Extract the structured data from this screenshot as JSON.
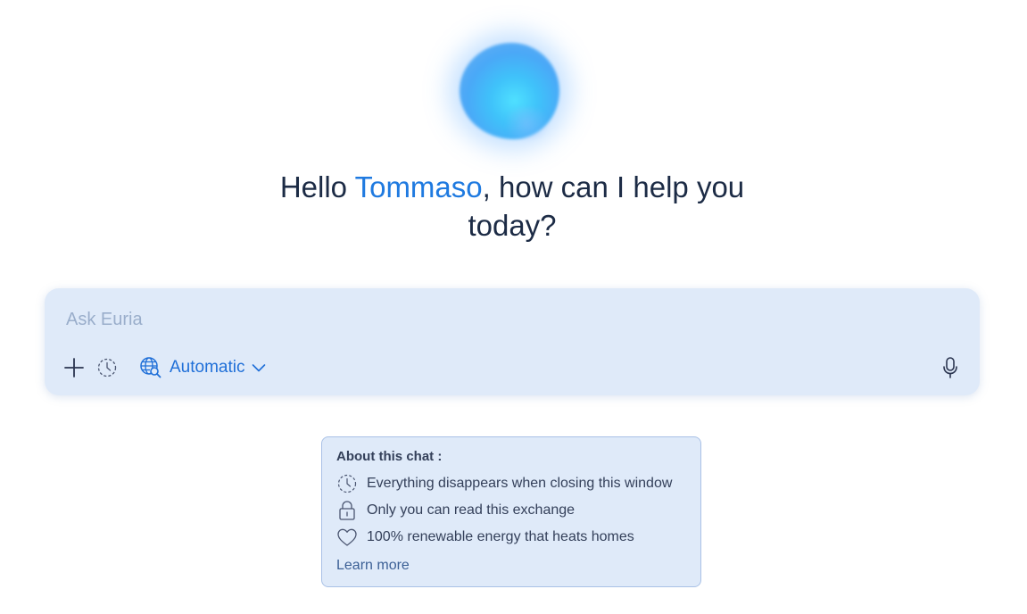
{
  "greeting": {
    "prefix": "Hello ",
    "name": "Tommaso",
    "suffix": ", how can I help you today?"
  },
  "composer": {
    "placeholder": "Ask Euria",
    "mode_label": "Automatic",
    "icons": [
      "plus-icon",
      "ephemeral-clock-icon",
      "web-search-globe-icon",
      "chevron-down-icon",
      "microphone-icon"
    ]
  },
  "info": {
    "title": "About this chat :",
    "items": [
      {
        "icon": "ephemeral-clock-icon",
        "text": "Everything disappears when closing this window"
      },
      {
        "icon": "lock-icon",
        "text": "Only you can read this exchange"
      },
      {
        "icon": "heart-icon",
        "text": "100% renewable energy that heats homes"
      }
    ],
    "learn_more": "Learn more"
  },
  "colors": {
    "accent": "#1f7ae0",
    "composer_bg": "#dfeaf9",
    "text": "#1c2b45"
  }
}
